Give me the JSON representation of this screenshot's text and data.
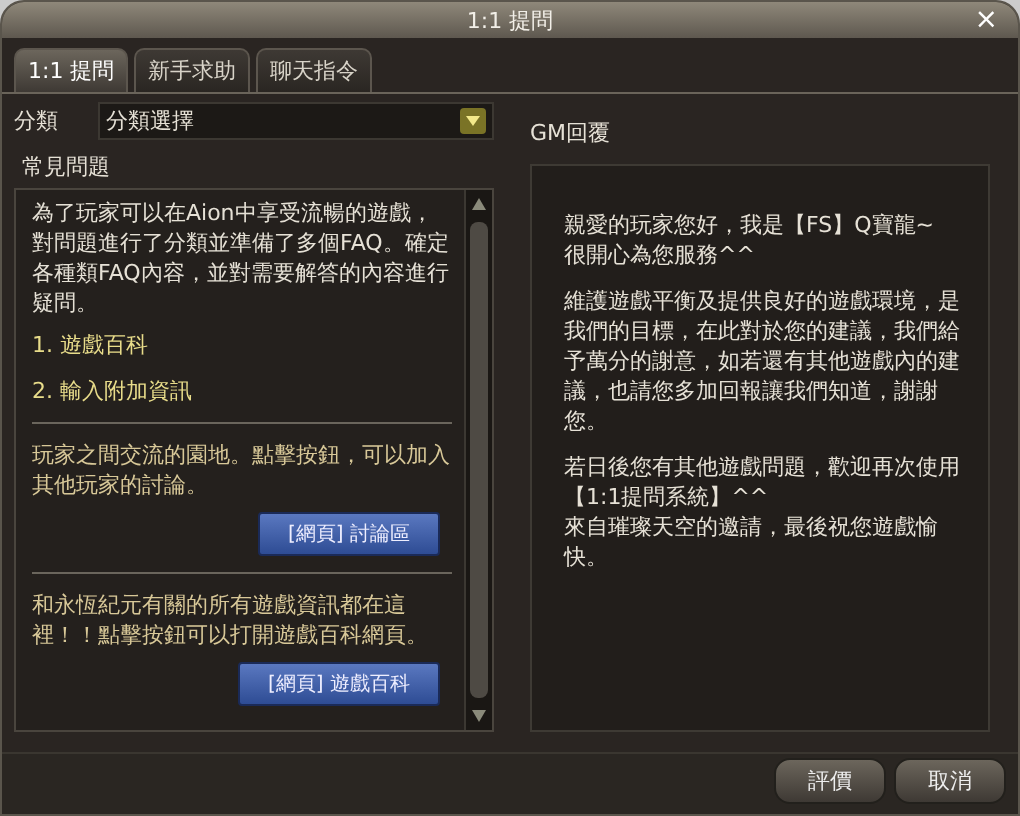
{
  "window": {
    "title": "1:1 提問",
    "close": "×"
  },
  "tabs": [
    {
      "label": "1:1 提問",
      "selected": true
    },
    {
      "label": "新手求助",
      "selected": false
    },
    {
      "label": "聊天指令",
      "selected": false
    }
  ],
  "category": {
    "label": "分類",
    "value": "分類選擇"
  },
  "faq": {
    "title": "常見問題",
    "intro": "為了玩家可以在Aion中享受流暢的遊戲，對問題進行了分類並準備了多個FAQ。確定各種類FAQ內容，並對需要解答的內容進行疑問。",
    "links": [
      "1. 遊戲百科",
      "2. 輸入附加資訊"
    ],
    "sections": [
      {
        "text": "玩家之間交流的園地。點擊按鈕，可以加入其他玩家的討論。",
        "button": "[網頁] 討論區"
      },
      {
        "text": "和永恆紀元有關的所有遊戲資訊都在這裡！！點擊按鈕可以打開遊戲百科網頁。",
        "button": "[網頁] 遊戲百科"
      }
    ]
  },
  "reply": {
    "title": "GM回覆",
    "paragraphs": [
      "親愛的玩家您好，我是【FS】Q寶龍~\n很開心為您服務^^",
      "維護遊戲平衡及提供良好的遊戲環境，是我們的目標，在此對於您的建議，我們給予萬分的謝意，如若還有其他遊戲內的建議，也請您多加回報讓我們知道，謝謝您。",
      "若日後您有其他遊戲問題，歡迎再次使用【1:1提問系統】^^\n來自璀璨天空的邀請，最後祝您遊戲愉快。"
    ]
  },
  "buttons": [
    "評價",
    "取消"
  ]
}
